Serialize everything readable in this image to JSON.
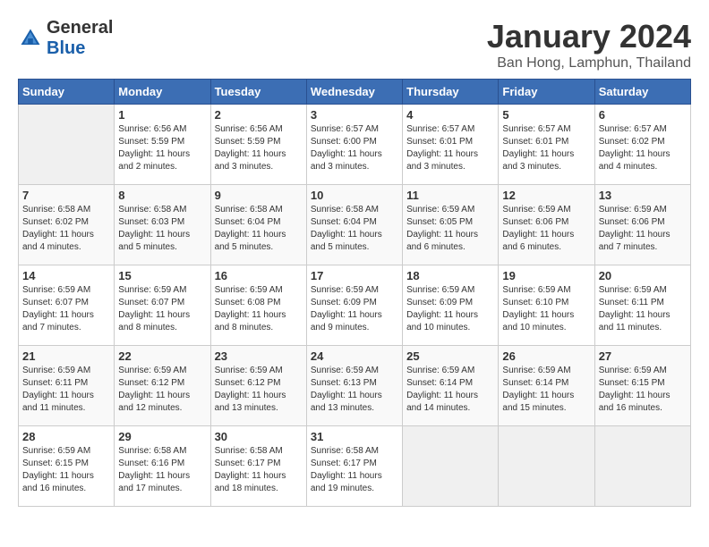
{
  "header": {
    "logo_general": "General",
    "logo_blue": "Blue",
    "month_title": "January 2024",
    "location": "Ban Hong, Lamphun, Thailand"
  },
  "days_of_week": [
    "Sunday",
    "Monday",
    "Tuesday",
    "Wednesday",
    "Thursday",
    "Friday",
    "Saturday"
  ],
  "weeks": [
    [
      {
        "day": "",
        "info": ""
      },
      {
        "day": "1",
        "info": "Sunrise: 6:56 AM\nSunset: 5:59 PM\nDaylight: 11 hours\nand 2 minutes."
      },
      {
        "day": "2",
        "info": "Sunrise: 6:56 AM\nSunset: 5:59 PM\nDaylight: 11 hours\nand 3 minutes."
      },
      {
        "day": "3",
        "info": "Sunrise: 6:57 AM\nSunset: 6:00 PM\nDaylight: 11 hours\nand 3 minutes."
      },
      {
        "day": "4",
        "info": "Sunrise: 6:57 AM\nSunset: 6:01 PM\nDaylight: 11 hours\nand 3 minutes."
      },
      {
        "day": "5",
        "info": "Sunrise: 6:57 AM\nSunset: 6:01 PM\nDaylight: 11 hours\nand 3 minutes."
      },
      {
        "day": "6",
        "info": "Sunrise: 6:57 AM\nSunset: 6:02 PM\nDaylight: 11 hours\nand 4 minutes."
      }
    ],
    [
      {
        "day": "7",
        "info": "Sunrise: 6:58 AM\nSunset: 6:02 PM\nDaylight: 11 hours\nand 4 minutes."
      },
      {
        "day": "8",
        "info": "Sunrise: 6:58 AM\nSunset: 6:03 PM\nDaylight: 11 hours\nand 5 minutes."
      },
      {
        "day": "9",
        "info": "Sunrise: 6:58 AM\nSunset: 6:04 PM\nDaylight: 11 hours\nand 5 minutes."
      },
      {
        "day": "10",
        "info": "Sunrise: 6:58 AM\nSunset: 6:04 PM\nDaylight: 11 hours\nand 5 minutes."
      },
      {
        "day": "11",
        "info": "Sunrise: 6:59 AM\nSunset: 6:05 PM\nDaylight: 11 hours\nand 6 minutes."
      },
      {
        "day": "12",
        "info": "Sunrise: 6:59 AM\nSunset: 6:06 PM\nDaylight: 11 hours\nand 6 minutes."
      },
      {
        "day": "13",
        "info": "Sunrise: 6:59 AM\nSunset: 6:06 PM\nDaylight: 11 hours\nand 7 minutes."
      }
    ],
    [
      {
        "day": "14",
        "info": "Sunrise: 6:59 AM\nSunset: 6:07 PM\nDaylight: 11 hours\nand 7 minutes."
      },
      {
        "day": "15",
        "info": "Sunrise: 6:59 AM\nSunset: 6:07 PM\nDaylight: 11 hours\nand 8 minutes."
      },
      {
        "day": "16",
        "info": "Sunrise: 6:59 AM\nSunset: 6:08 PM\nDaylight: 11 hours\nand 8 minutes."
      },
      {
        "day": "17",
        "info": "Sunrise: 6:59 AM\nSunset: 6:09 PM\nDaylight: 11 hours\nand 9 minutes."
      },
      {
        "day": "18",
        "info": "Sunrise: 6:59 AM\nSunset: 6:09 PM\nDaylight: 11 hours\nand 10 minutes."
      },
      {
        "day": "19",
        "info": "Sunrise: 6:59 AM\nSunset: 6:10 PM\nDaylight: 11 hours\nand 10 minutes."
      },
      {
        "day": "20",
        "info": "Sunrise: 6:59 AM\nSunset: 6:11 PM\nDaylight: 11 hours\nand 11 minutes."
      }
    ],
    [
      {
        "day": "21",
        "info": "Sunrise: 6:59 AM\nSunset: 6:11 PM\nDaylight: 11 hours\nand 11 minutes."
      },
      {
        "day": "22",
        "info": "Sunrise: 6:59 AM\nSunset: 6:12 PM\nDaylight: 11 hours\nand 12 minutes."
      },
      {
        "day": "23",
        "info": "Sunrise: 6:59 AM\nSunset: 6:12 PM\nDaylight: 11 hours\nand 13 minutes."
      },
      {
        "day": "24",
        "info": "Sunrise: 6:59 AM\nSunset: 6:13 PM\nDaylight: 11 hours\nand 13 minutes."
      },
      {
        "day": "25",
        "info": "Sunrise: 6:59 AM\nSunset: 6:14 PM\nDaylight: 11 hours\nand 14 minutes."
      },
      {
        "day": "26",
        "info": "Sunrise: 6:59 AM\nSunset: 6:14 PM\nDaylight: 11 hours\nand 15 minutes."
      },
      {
        "day": "27",
        "info": "Sunrise: 6:59 AM\nSunset: 6:15 PM\nDaylight: 11 hours\nand 16 minutes."
      }
    ],
    [
      {
        "day": "28",
        "info": "Sunrise: 6:59 AM\nSunset: 6:15 PM\nDaylight: 11 hours\nand 16 minutes."
      },
      {
        "day": "29",
        "info": "Sunrise: 6:58 AM\nSunset: 6:16 PM\nDaylight: 11 hours\nand 17 minutes."
      },
      {
        "day": "30",
        "info": "Sunrise: 6:58 AM\nSunset: 6:17 PM\nDaylight: 11 hours\nand 18 minutes."
      },
      {
        "day": "31",
        "info": "Sunrise: 6:58 AM\nSunset: 6:17 PM\nDaylight: 11 hours\nand 19 minutes."
      },
      {
        "day": "",
        "info": ""
      },
      {
        "day": "",
        "info": ""
      },
      {
        "day": "",
        "info": ""
      }
    ]
  ]
}
